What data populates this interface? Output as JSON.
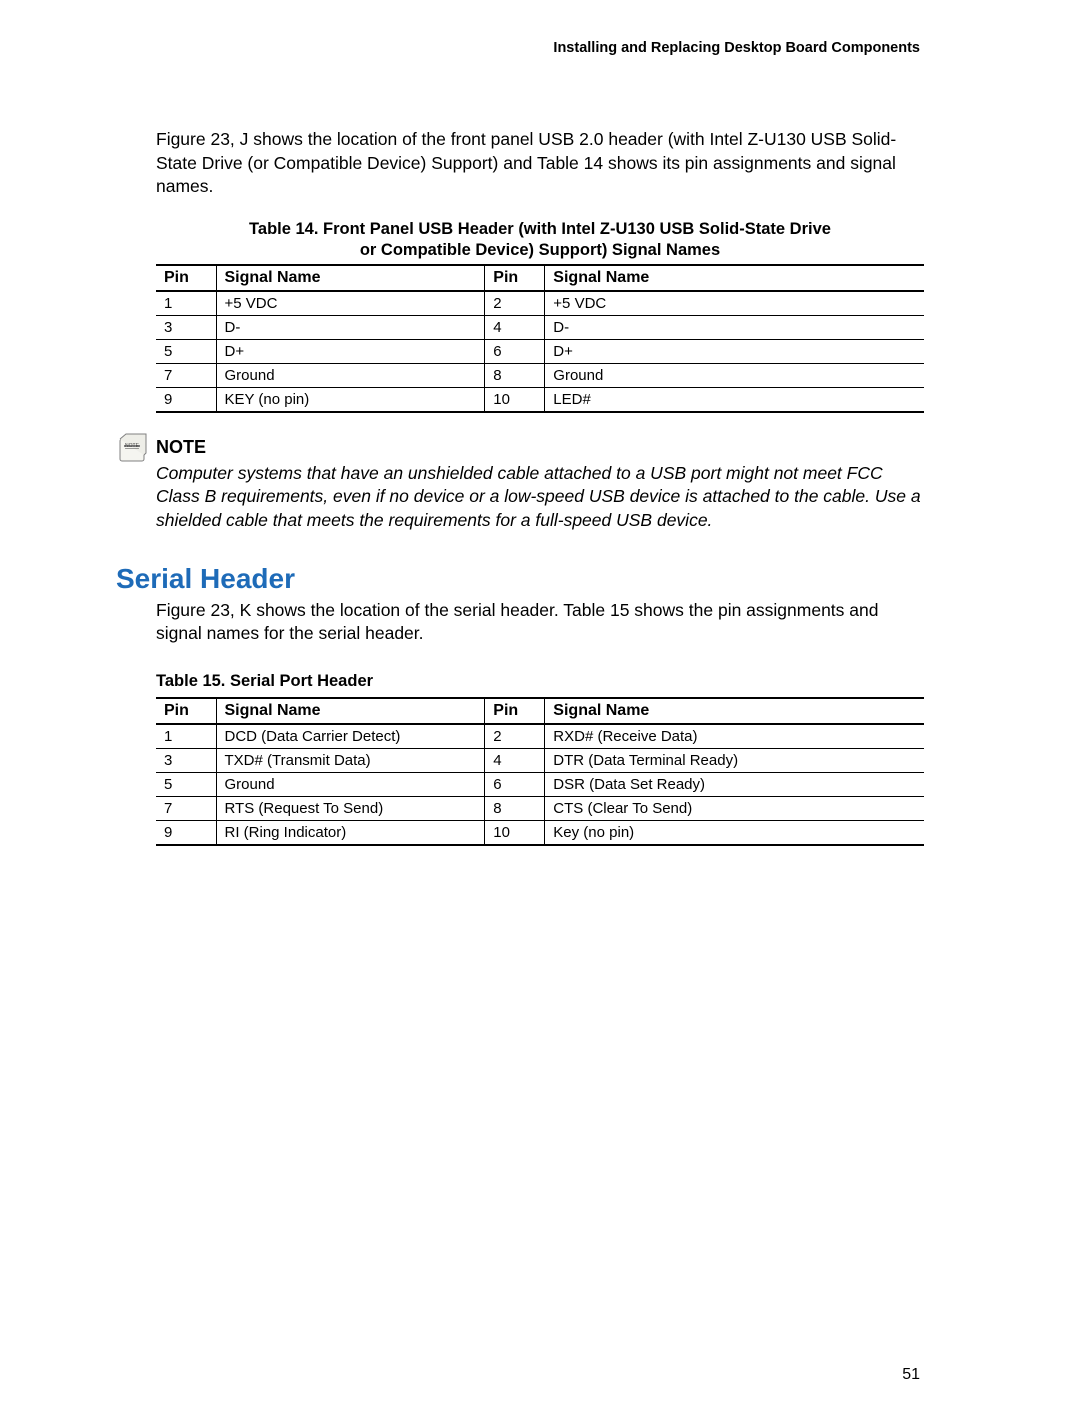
{
  "header": {
    "running_title": "Installing and Replacing Desktop Board Components"
  },
  "intro_paragraph": "Figure 23, J shows the location of the front panel USB 2.0 header (with Intel Z-U130 USB Solid-State Drive (or Compatible Device) Support) and Table 14 shows its pin assignments and signal names.",
  "table14": {
    "caption_line1": "Table 14.  Front Panel USB Header (with Intel Z-U130 USB Solid-State Drive",
    "caption_line2": "or Compatible Device) Support) Signal Names",
    "headers": {
      "pin": "Pin",
      "signal": "Signal Name"
    },
    "rows": [
      {
        "p1": "1",
        "s1": "+5 VDC",
        "p2": "2",
        "s2": "+5 VDC"
      },
      {
        "p1": "3",
        "s1": "D-",
        "p2": "4",
        "s2": "D-"
      },
      {
        "p1": "5",
        "s1": "D+",
        "p2": "6",
        "s2": "D+"
      },
      {
        "p1": "7",
        "s1": "Ground",
        "p2": "8",
        "s2": "Ground"
      },
      {
        "p1": "9",
        "s1": "KEY (no pin)",
        "p2": "10",
        "s2": "LED#"
      }
    ]
  },
  "note": {
    "label": "NOTE",
    "body": "Computer systems that have an unshielded cable attached to a USB port might not meet FCC Class B requirements, even if no device or a low-speed USB device is attached to the cable.  Use a shielded cable that meets the requirements for a full-speed USB device."
  },
  "section_heading": "Serial Header",
  "serial_intro": "Figure 23, K shows the location of the serial header.  Table 15 shows the pin assignments and signal names for the serial header.",
  "table15": {
    "caption": "Table 15. Serial Port Header",
    "headers": {
      "pin": "Pin",
      "signal": "Signal Name"
    },
    "rows": [
      {
        "p1": "1",
        "s1": "DCD (Data Carrier Detect)",
        "p2": "2",
        "s2": "RXD# (Receive Data)"
      },
      {
        "p1": "3",
        "s1": "TXD# (Transmit Data)",
        "p2": "4",
        "s2": "DTR (Data Terminal Ready)"
      },
      {
        "p1": "5",
        "s1": "Ground",
        "p2": "6",
        "s2": "DSR (Data Set Ready)"
      },
      {
        "p1": "7",
        "s1": "RTS (Request To Send)",
        "p2": "8",
        "s2": "CTS (Clear To Send)"
      },
      {
        "p1": "9",
        "s1": "RI (Ring Indicator)",
        "p2": "10",
        "s2": "Key (no pin)"
      }
    ]
  },
  "page_number": "51"
}
